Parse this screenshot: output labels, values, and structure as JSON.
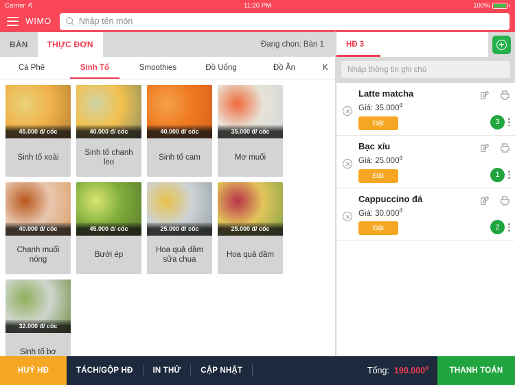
{
  "statusbar": {
    "carrier": "Carrier",
    "time": "11:20 PM",
    "battery": "100%"
  },
  "header": {
    "brand": "WIMO",
    "search_placeholder": "Nhập tên món"
  },
  "main_tabs": {
    "items": [
      {
        "label": "BÀN",
        "active": false
      },
      {
        "label": "THỰC ĐƠN",
        "active": true
      }
    ],
    "table_note": "Đang chọn: Bàn 1"
  },
  "categories": {
    "items": [
      {
        "label": "Cà Phê",
        "active": false
      },
      {
        "label": "Sinh Tố",
        "active": true
      },
      {
        "label": "Smoothies",
        "active": false
      },
      {
        "label": "Đồ Uống",
        "active": false
      },
      {
        "label": "Đồ Ăn",
        "active": false
      },
      {
        "label": "K",
        "active": false
      }
    ]
  },
  "products": [
    {
      "name": "Sinh tố xoài",
      "price": "45.000 đ/ cốc",
      "c1": "#f0b24a",
      "c2": "#e8d27a",
      "c3": "#b98236"
    },
    {
      "name": "Sinh tố chanh leo",
      "price": "40.000 đ/ cốc",
      "c1": "#f2c14e",
      "c2": "#cfd3a6",
      "c3": "#8e8f63"
    },
    {
      "name": "Sinh tố cam",
      "price": "40.000 đ/ cốc",
      "c1": "#f07a22",
      "c2": "#f5a34a",
      "c3": "#d4601a"
    },
    {
      "name": "Mơ muối",
      "price": "35.000 đ/ cốc",
      "c1": "#e8e2d6",
      "c2": "#ef6a3c",
      "c3": "#cfd8dd"
    },
    {
      "name": "Chanh muối nóng",
      "price": "40.000 đ/ cốc",
      "c1": "#e9c7ae",
      "c2": "#b8561d",
      "c3": "#d9a06a"
    },
    {
      "name": "Bưởi ép",
      "price": "45.000 đ/ cốc",
      "c1": "#7fae3c",
      "c2": "#dbe56f",
      "c3": "#5c7a2c"
    },
    {
      "name": "Hoa quả dầm sữa chua",
      "price": "25.000 đ/ cốc",
      "c1": "#cdd3d6",
      "c2": "#e8c24a",
      "c3": "#9aa3a8"
    },
    {
      "name": "Hoa quả dầm",
      "price": "25.000 đ/ cốc",
      "c1": "#e3c55a",
      "c2": "#b8324a",
      "c3": "#86a34a"
    },
    {
      "name": "Sinh tố bơ",
      "price": "32.000 đ/ cốc",
      "c1": "#cfd6cd",
      "c2": "#8fae5c",
      "c3": "#6f8f45"
    }
  ],
  "bill": {
    "tab_label": "HĐ 3",
    "add_label": "+",
    "note_placeholder": "Nhập thông tin ghi chú",
    "items": [
      {
        "name": "Latte matcha",
        "price_label": "Giá: 35.000",
        "currency": "đ",
        "action": "Đặt",
        "qty": "3"
      },
      {
        "name": "Bạc xỉu",
        "price_label": "Giá: 25.000",
        "currency": "đ",
        "action": "Đặt",
        "qty": "1"
      },
      {
        "name": "Cappuccino đá",
        "price_label": "Giá: 30.000",
        "currency": "đ",
        "action": "Đặt",
        "qty": "2"
      }
    ]
  },
  "bottom": {
    "cancel": "HUỶ HĐ",
    "actions": [
      {
        "label": "TÁCH/GỘP HĐ"
      },
      {
        "label": "IN THỬ"
      },
      {
        "label": "CẬP NHẬT"
      }
    ],
    "total_label": "Tổng:",
    "total_value": "190.000",
    "total_currency": "đ",
    "pay_label": "THANH TOÁN"
  },
  "colors": {
    "brand_red": "#f94757",
    "accent_red": "#ef3b4e",
    "green": "#21a53f",
    "orange": "#f5a623",
    "dark": "#1d2a3d"
  }
}
